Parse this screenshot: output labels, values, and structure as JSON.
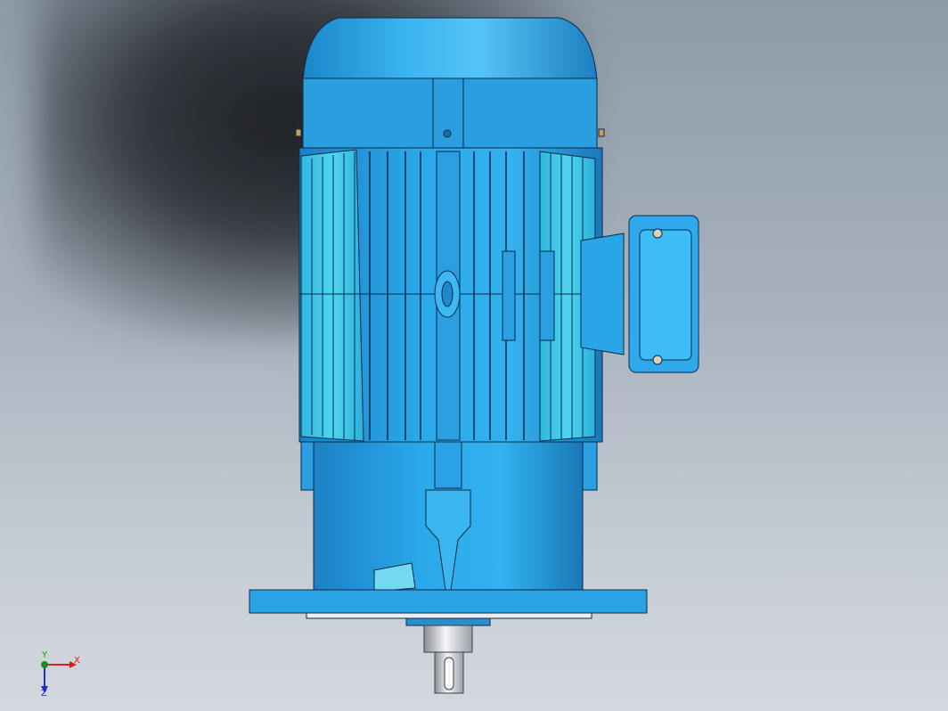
{
  "view": {
    "background_top": "#8e9aa8",
    "background_bottom": "#d3d8de"
  },
  "model": {
    "name": "motor-3d-model",
    "body_color": "#29a8e8",
    "fin_color": "#3ecae8",
    "outline_color": "#0a2a4a"
  },
  "triad": {
    "x_label": "X",
    "y_label": "Y",
    "z_label": "Z",
    "x_color": "#d42020",
    "y_color": "#1a8c1a",
    "z_color": "#2030c0"
  }
}
